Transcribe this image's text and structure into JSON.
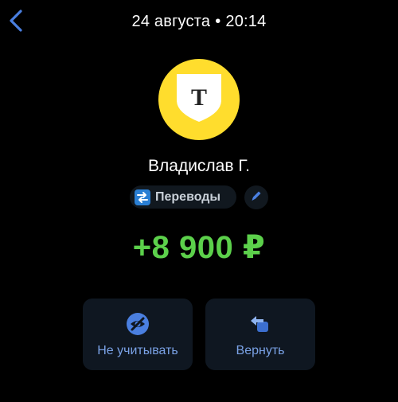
{
  "header": {
    "date": "24 августа",
    "separator": "•",
    "time": "20:14",
    "back_icon": "chevron-left-icon"
  },
  "merchant": {
    "logo_letter": "Т",
    "logo_color": "#ffdd2d",
    "name": "Владислав Г."
  },
  "category": {
    "label": "Переводы",
    "icon": "transfer-arrows-icon",
    "edit_icon": "pencil-icon"
  },
  "amount": {
    "value": "+8 900 ₽",
    "color": "#5cd04b"
  },
  "actions": [
    {
      "label": "Не учитывать",
      "icon": "eye-off-icon"
    },
    {
      "label": "Вернуть",
      "icon": "return-arrow-icon"
    }
  ],
  "colors": {
    "accent": "#4a7fe0",
    "background": "#000000",
    "card": "#0f1721"
  }
}
